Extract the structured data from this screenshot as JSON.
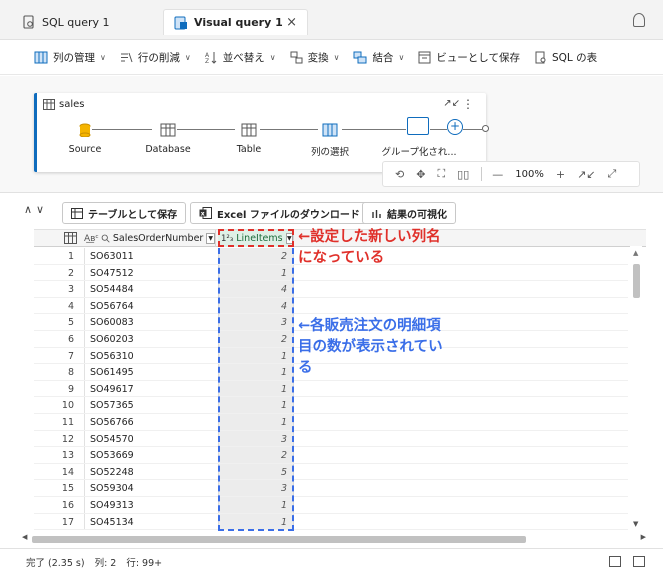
{
  "tabs": {
    "tab1_label": "SQL query 1",
    "tab2_label": "Visual query 1",
    "tab2_close": "×"
  },
  "ribbon": {
    "items": [
      "列の管理",
      "行の削減",
      "並べ替え",
      "変換",
      "結合",
      "ビューとして保存",
      "SQL の表"
    ]
  },
  "diagram": {
    "query_name": "sales",
    "steps": [
      "Source",
      "Database",
      "Table",
      "列の選択",
      "グループ化され..."
    ],
    "zoom_level": "100%"
  },
  "results_toolbar": {
    "save_table": "テーブルとして保存",
    "excel_download": "Excel ファイルのダウンロード",
    "visualize": "結果の可視化"
  },
  "grid": {
    "col1_header": "SalesOrderNumber",
    "col2_header": "LineItems",
    "col2_type": "1²₃",
    "rows": [
      {
        "n": "1",
        "order": "SO63011",
        "items": "2"
      },
      {
        "n": "2",
        "order": "SO47512",
        "items": "1"
      },
      {
        "n": "3",
        "order": "SO54484",
        "items": "4"
      },
      {
        "n": "4",
        "order": "SO56764",
        "items": "4"
      },
      {
        "n": "5",
        "order": "SO60083",
        "items": "3"
      },
      {
        "n": "6",
        "order": "SO60203",
        "items": "2"
      },
      {
        "n": "7",
        "order": "SO56310",
        "items": "1"
      },
      {
        "n": "8",
        "order": "SO61495",
        "items": "1"
      },
      {
        "n": "9",
        "order": "SO49617",
        "items": "1"
      },
      {
        "n": "10",
        "order": "SO57365",
        "items": "1"
      },
      {
        "n": "11",
        "order": "SO56766",
        "items": "1"
      },
      {
        "n": "12",
        "order": "SO54570",
        "items": "3"
      },
      {
        "n": "13",
        "order": "SO53669",
        "items": "2"
      },
      {
        "n": "14",
        "order": "SO52248",
        "items": "5"
      },
      {
        "n": "15",
        "order": "SO59304",
        "items": "3"
      },
      {
        "n": "16",
        "order": "SO49313",
        "items": "1"
      },
      {
        "n": "17",
        "order": "SO45134",
        "items": "1"
      }
    ]
  },
  "status": {
    "done": "完了 (2.35 s)",
    "columns": "列: 2",
    "rows": "行: 99+"
  },
  "annotations": {
    "red_line1": "←設定した新しい列名",
    "red_line2": "になっている",
    "blue_line1": "←各販売注文の明細項",
    "blue_line2": "目の数が表示されてい",
    "blue_line3": "る"
  },
  "colors": {
    "accent": "#0f6cbd",
    "annotation_red": "#e0302a",
    "annotation_blue": "#3a6ee8",
    "new_column_header": "#dff0e7"
  }
}
